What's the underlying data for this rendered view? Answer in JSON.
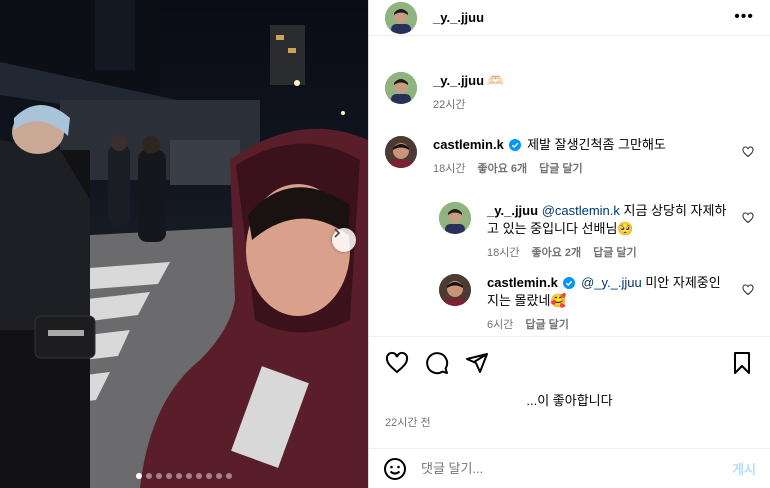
{
  "post": {
    "author": "_y._.jjuu",
    "photo_count": 10,
    "photo_index": 1
  },
  "caption": {
    "user": "_y._.jjuu",
    "text": "🫶🏻",
    "time": "22시간"
  },
  "comments": [
    {
      "user": "castlemin.k",
      "verified": true,
      "text": "제발 잘생긴척좀 그만해도",
      "time": "18시간",
      "likes": "좋아요 6개",
      "reply": "답글 달기"
    },
    {
      "user": "_y._.jjuu",
      "verified": false,
      "mention": "@castlemin.k",
      "text": " 지금 상당히 자제하고 있는 중입니다 선배님🥺",
      "time": "18시간",
      "likes": "좋아요 2개",
      "reply": "답글 달기"
    },
    {
      "user": "castlemin.k",
      "verified": true,
      "mention": "@_y._.jjuu",
      "text": " 미안 자제중인지는 몰랐네🥰",
      "time": "6시간",
      "reply": "답글 달기"
    }
  ],
  "likes_text": "...이 좋아합니다",
  "post_time": "22시간 전",
  "composer": {
    "placeholder": "댓글 달기...",
    "submit": "게시"
  },
  "colors": {
    "link": "#00376b",
    "secondary": "#737373",
    "post_button": "#b2dffc",
    "verified": "#0095f6"
  },
  "icons": [
    "more-icon",
    "heart-icon",
    "comment-icon",
    "share-icon",
    "bookmark-icon",
    "emoji-icon",
    "verified-icon",
    "chevron-right-icon"
  ]
}
